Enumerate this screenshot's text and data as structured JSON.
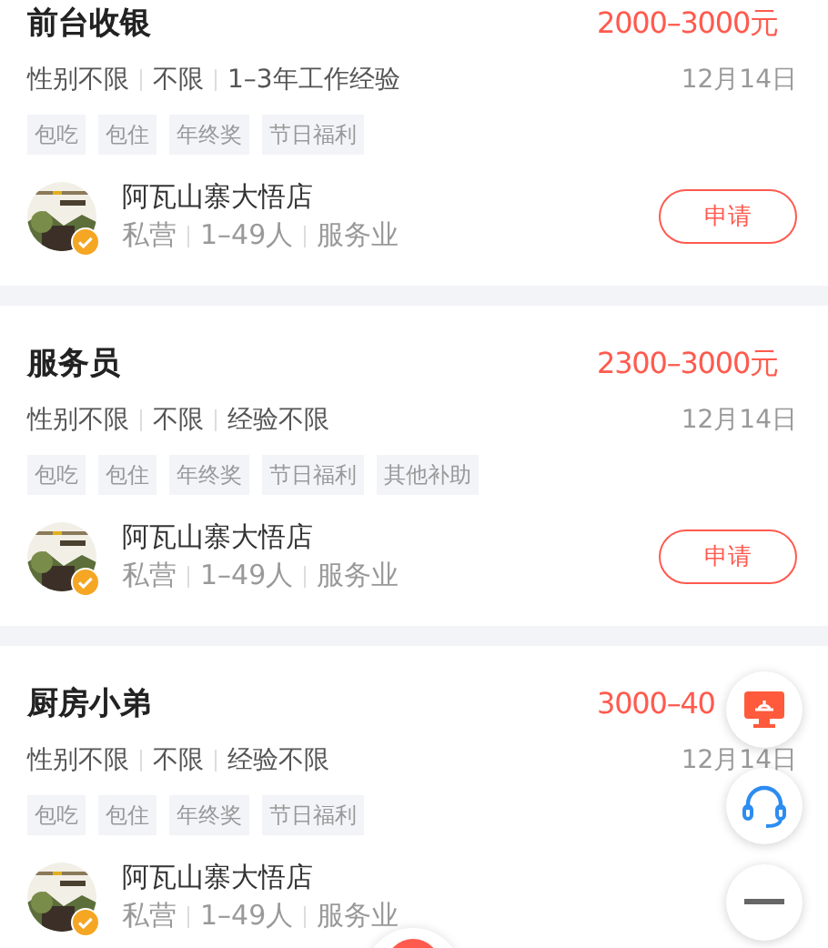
{
  "jobs": [
    {
      "title": "前台收银",
      "salary": "2000–3000元",
      "meta": [
        "性别不限",
        "不限",
        "1–3年工作经验"
      ],
      "date": "12月14日",
      "tags": [
        "包吃",
        "包住",
        "年终奖",
        "节日福利"
      ],
      "company": {
        "name": "阿瓦山寨大悟店",
        "meta": [
          "私营",
          "1–49人",
          "服务业"
        ],
        "verified": true
      },
      "apply": "申请"
    },
    {
      "title": "服务员",
      "salary": "2300–3000元",
      "meta": [
        "性别不限",
        "不限",
        "经验不限"
      ],
      "date": "12月14日",
      "tags": [
        "包吃",
        "包住",
        "年终奖",
        "节日福利",
        "其他补助"
      ],
      "company": {
        "name": "阿瓦山寨大悟店",
        "meta": [
          "私营",
          "1–49人",
          "服务业"
        ],
        "verified": true
      },
      "apply": "申请"
    },
    {
      "title": "厨房小弟",
      "salary": "3000–40",
      "meta": [
        "性别不限",
        "不限",
        "经验不限"
      ],
      "date": "12月14日",
      "tags": [
        "包吃",
        "包住",
        "年终奖",
        "节日福利"
      ],
      "company": {
        "name": "阿瓦山寨大悟店",
        "meta": [
          "私营",
          "1–49人",
          "服务业"
        ],
        "verified": true
      }
    }
  ]
}
